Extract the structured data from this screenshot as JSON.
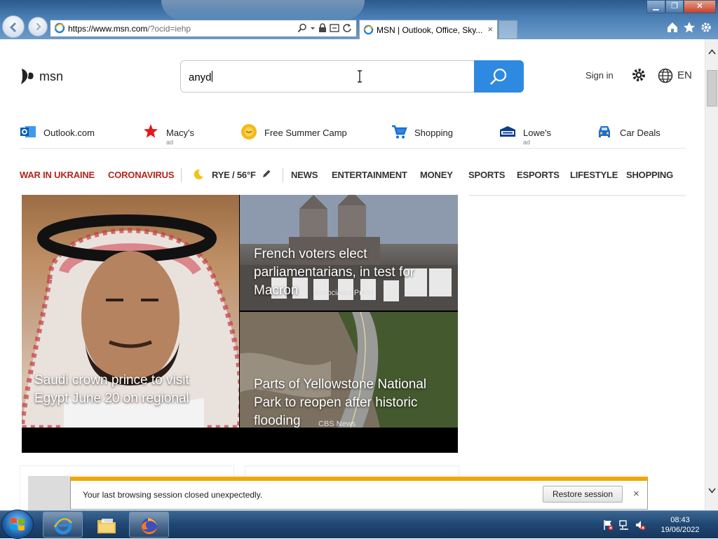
{
  "browser": {
    "url_main": "https://www.msn.com",
    "url_rest": "/?ocid=iehp",
    "tab_title": "MSN | Outlook, Office, Sky...",
    "tab_close": "×"
  },
  "header": {
    "logo_text": "msn",
    "search_value": "anyd",
    "sign_in": "Sign in",
    "language": "EN"
  },
  "quick_links": [
    {
      "label": "Outlook.com",
      "ad": ""
    },
    {
      "label": "Macy's",
      "ad": "ad"
    },
    {
      "label": "Free Summer Camp",
      "ad": ""
    },
    {
      "label": "Shopping",
      "ad": ""
    },
    {
      "label": "Lowe's",
      "ad": "ad"
    },
    {
      "label": "Car Deals",
      "ad": ""
    }
  ],
  "nav": {
    "items": [
      "WAR IN UKRAINE",
      "CORONAVIRUS",
      "RYE / 56°F",
      "NEWS",
      "ENTERTAINMENT",
      "MONEY",
      "SPORTS",
      "ESPORTS",
      "LIFESTYLE",
      "SHOPPING"
    ]
  },
  "news": [
    {
      "title": "Saudi crown prince to visit Egypt June 20 on regional",
      "source": ""
    },
    {
      "title": "French voters elect parliamentarians, in test for Macron",
      "source": "Associated Press"
    },
    {
      "title": "Parts of Yellowstone National Park to reopen after historic flooding",
      "source": "CBS News"
    }
  ],
  "notification": {
    "message": "Your last browsing session closed unexpectedly.",
    "button": "Restore session",
    "close": "×"
  },
  "taskbar": {
    "time": "08:43",
    "date": "19/06/2022"
  },
  "colors": {
    "accent_blue": "#2d8ae0",
    "nav_red": "#b3261e",
    "notice_bar": "#f0a800"
  }
}
